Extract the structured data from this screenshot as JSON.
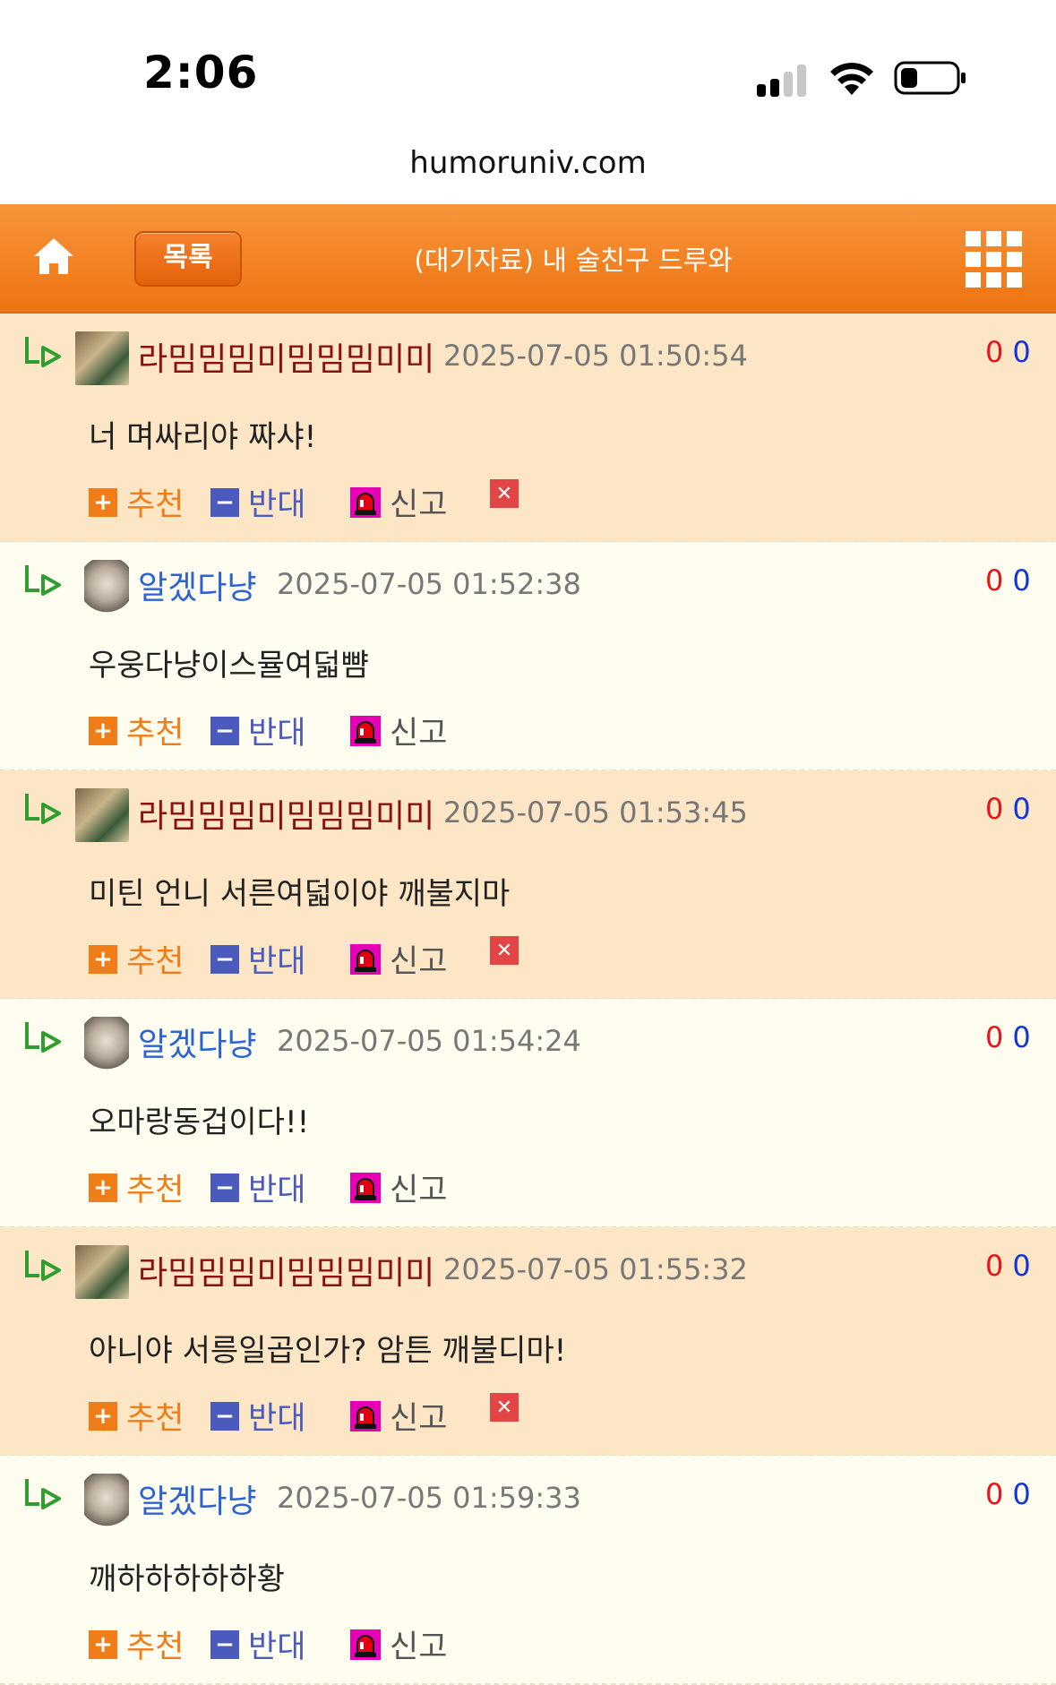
{
  "status_bar": {
    "time": "2:06"
  },
  "browser": {
    "url": "humoruniv.com"
  },
  "header": {
    "list_label": "목록",
    "title": "(대기자료) 내 술친구 드루와"
  },
  "actions": {
    "recommend": "추천",
    "oppose": "반대",
    "report": "신고"
  },
  "comments": [
    {
      "nick": "라밈밈밈미밈밈밈미미",
      "date": "2025-07-05 01:50:54",
      "text": "너 며싸리야 짜샤!",
      "up": "0",
      "down": "0"
    },
    {
      "nick": "알겠다냥",
      "date": "2025-07-05 01:52:38",
      "text": "우웅다냥이스뮬여덟뺨",
      "up": "0",
      "down": "0"
    },
    {
      "nick": "라밈밈밈미밈밈밈미미",
      "date": "2025-07-05 01:53:45",
      "text": "미틴 언니 서른여덟이야 깨불지마",
      "up": "0",
      "down": "0"
    },
    {
      "nick": "알겠다냥",
      "date": "2025-07-05 01:54:24",
      "text": "오마랑동겁이다!!",
      "up": "0",
      "down": "0"
    },
    {
      "nick": "라밈밈밈미밈밈밈미미",
      "date": "2025-07-05 01:55:32",
      "text": "아니야 서릉일곱인가? 암튼 깨불디마!",
      "up": "0",
      "down": "0"
    },
    {
      "nick": "알겠다냥",
      "date": "2025-07-05 01:59:33",
      "text": "깨하하하하하황",
      "up": "0",
      "down": "0"
    }
  ]
}
